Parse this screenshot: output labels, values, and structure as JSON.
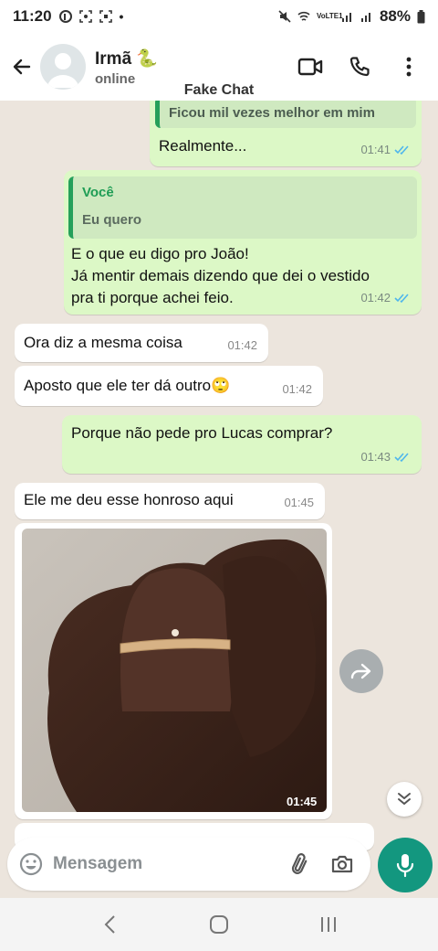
{
  "status_bar": {
    "time": "11:20",
    "network_label": "VoLTE1",
    "battery": "88%"
  },
  "header": {
    "contact_name": "Irmã 🐍",
    "contact_status": "online"
  },
  "overlay_label": "Fake Chat",
  "messages": [
    {
      "direction": "out",
      "quote_text": "Ficou mil vezes melhor em mim",
      "text": "Realmente...",
      "time": "01:41",
      "read": true
    },
    {
      "direction": "out",
      "quote_author": "Você",
      "quote_text": "Eu quero",
      "text_lines": [
        "E o que eu digo pro João!",
        "Já mentir demais dizendo que dei o vestido",
        "pra ti porque achei feio."
      ],
      "time": "01:42",
      "read": true
    },
    {
      "direction": "in",
      "text": "Ora diz a mesma coisa",
      "time": "01:42"
    },
    {
      "direction": "in",
      "text": "Aposto que ele ter dá outro🙄",
      "time": "01:42"
    },
    {
      "direction": "out",
      "text": "Porque não pede pro Lucas comprar?",
      "time": "01:43",
      "read": true
    },
    {
      "direction": "in",
      "text": "Ele me deu esse honroso aqui",
      "time": "01:45"
    },
    {
      "direction": "in",
      "type": "image",
      "caption": "ring on finger",
      "time": "01:45"
    }
  ],
  "composer": {
    "placeholder": "Mensagem"
  },
  "icons": {
    "back": "arrow-left-icon",
    "video": "video-call-icon",
    "call": "phone-icon",
    "menu": "more-vert-icon",
    "emoji": "emoji-icon",
    "attach": "paperclip-icon",
    "camera": "camera-icon",
    "mic": "mic-icon",
    "forward": "forward-icon",
    "scroll": "double-chevron-down-icon"
  },
  "colors": {
    "outgoing_bubble": "#dcf8c6",
    "incoming_bubble": "#ffffff",
    "accent": "#13977f",
    "read_ticks": "#4fb6ec"
  }
}
